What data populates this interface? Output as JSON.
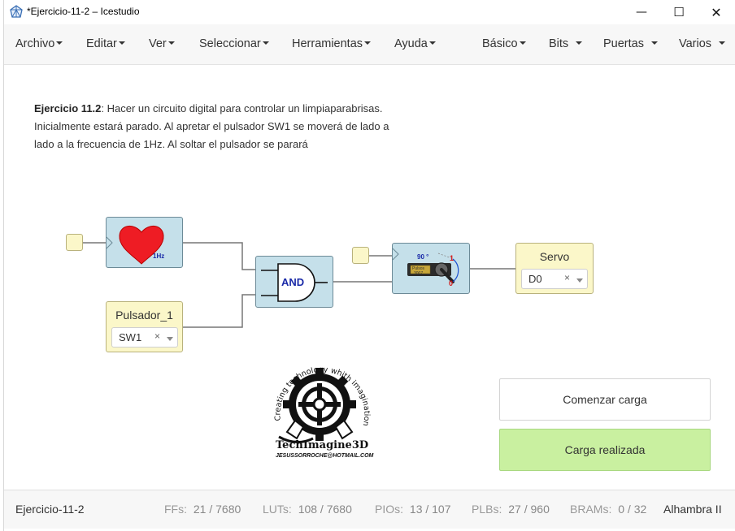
{
  "window": {
    "title": "*Ejercicio-11-2 – Icestudio"
  },
  "window_controls": {
    "minimize": "—",
    "maximize": "☐",
    "close": "✕"
  },
  "menu": {
    "left": [
      "Archivo",
      "Editar",
      "Ver",
      "Seleccionar",
      "Herramientas",
      "Ayuda"
    ],
    "right": [
      "Básico",
      "Bits",
      "Puertas",
      "Varios"
    ]
  },
  "description": {
    "bold": "Ejercicio 11.2",
    "line1": ": Hacer un circuito digital para controlar un limpiaparabrisas.",
    "line2": "Inicialmente estará parado. Al apretar el pulsador SW1 se moverá de lado a",
    "line3": "lado a la frecuencia de 1Hz. Al soltar el pulsador se parará"
  },
  "blocks": {
    "heart_label": "1Hz",
    "and_label": "AND",
    "servo_angle": "90 °",
    "servo_pulse1": "Pulsos",
    "servo_pulse2": "3007",
    "servo_one": "1",
    "servo_zero": "0"
  },
  "inputs": {
    "pulsador": {
      "title": "Pulsador_1",
      "value": "SW1",
      "clear": "×"
    },
    "servo": {
      "title": "Servo",
      "value": "D0",
      "clear": "×"
    }
  },
  "logo": {
    "arc_text": "Creating technology whith imagination",
    "brand": "TechImagine3D",
    "email": "JESUSSORROCHE@HOTMAIL.COM"
  },
  "buttons": {
    "start_load": "Comenzar carga",
    "load_done": "Carga realizada"
  },
  "footer": {
    "project": "Ejercicio-11-2",
    "ffs_label": "FFs:",
    "ffs": "21 / 7680",
    "luts_label": "LUTs:",
    "luts": "108 / 7680",
    "pios_label": "PIOs:",
    "pios": "13 / 107",
    "plbs_label": "PLBs:",
    "plbs": "27 / 960",
    "brams_label": "BRAMs:",
    "brams": "0 / 32",
    "board": "Alhambra II"
  },
  "colors": {
    "block": "#c5e0ea",
    "io": "#fbf7c9",
    "done_button": "#c9f0a0",
    "heart": "#ee1c24"
  }
}
